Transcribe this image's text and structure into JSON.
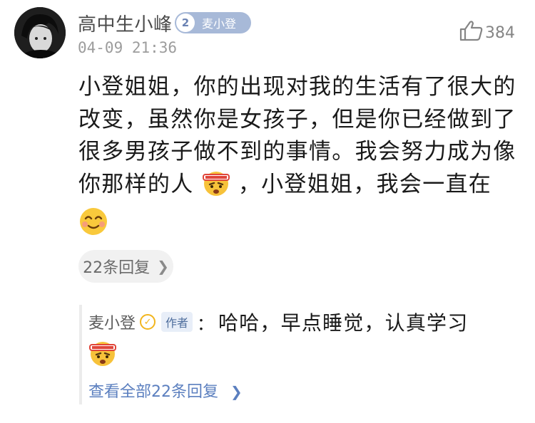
{
  "comment": {
    "username": "高中生小峰",
    "fan_badge": {
      "level": "2",
      "name": "麦小登"
    },
    "timestamp": "04-09 21:36",
    "likes": "384",
    "body_lines": [
      "小登姐姐，你的出现对我的生活有了很大的",
      "改变，虽然你是女孩子，但是你已经做到了",
      "很多男孩子做不到的事情。我会努力成为像",
      "你那样的人",
      "，小登姐姐，我会一直在"
    ],
    "replies_count_label": "22条回复",
    "emojis": [
      "determined-emoji",
      "smile-emoji"
    ]
  },
  "reply": {
    "author": "麦小登",
    "author_tag": "作者",
    "colon": "：",
    "text": "哈哈，早点睡觉，认真学习",
    "view_all_label": "查看全部22条回复"
  },
  "colors": {
    "badge": "#a7b9d8",
    "link": "#5b7fbf",
    "verified": "#f2b51d"
  }
}
